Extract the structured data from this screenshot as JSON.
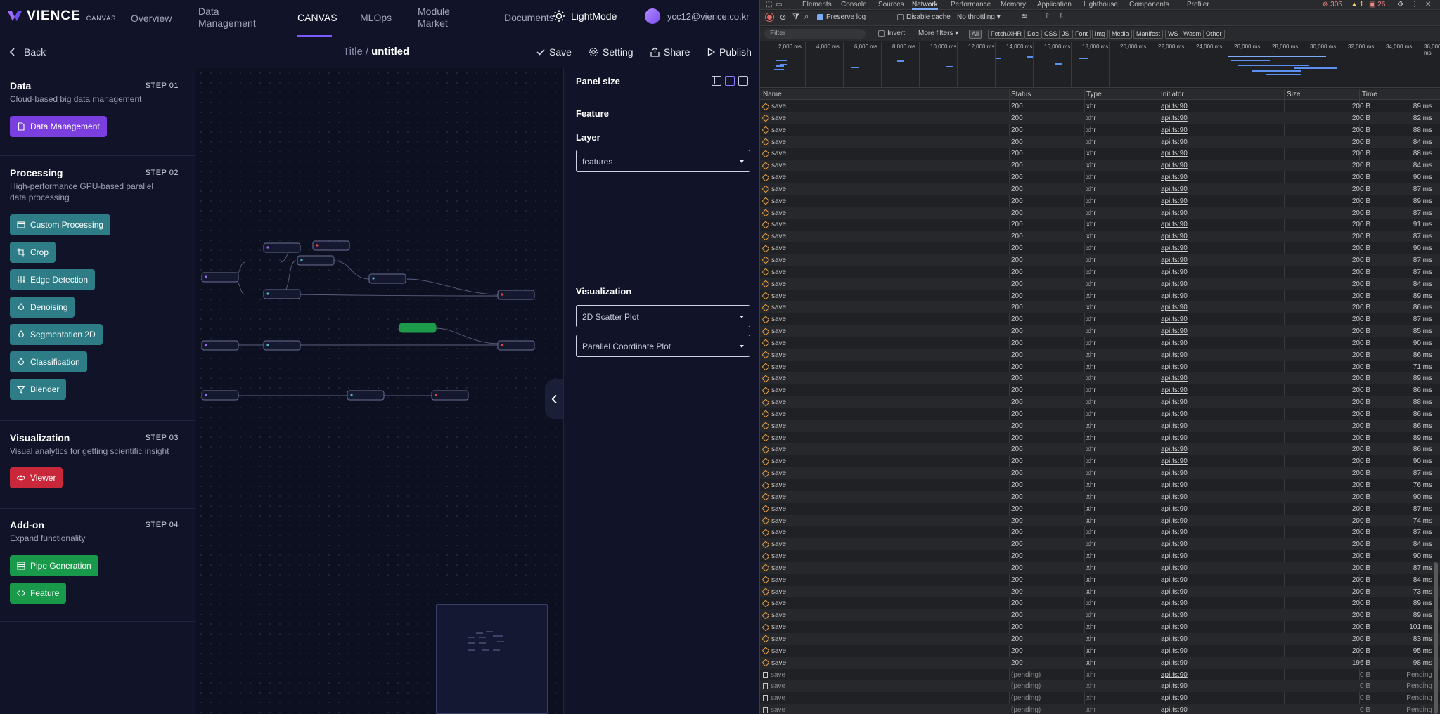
{
  "app": {
    "logo": {
      "brand": "VIENCE",
      "sub": "CANVAS"
    },
    "nav": [
      {
        "label": "Overview"
      },
      {
        "label": "Data Management"
      },
      {
        "label": "CANVAS"
      },
      {
        "label": "MLOps"
      },
      {
        "label": "Module Market"
      },
      {
        "label": "Documents"
      }
    ],
    "theme_label": "LightMode",
    "user_email": "ycc12@vience.co.kr",
    "back_label": "Back",
    "doc": {
      "title_prefix": "Title /",
      "title": "untitled"
    },
    "tools": {
      "save": "Save",
      "setting": "Setting",
      "share": "Share",
      "publish": "Publish"
    },
    "sections": [
      {
        "title": "Data",
        "step": "STEP 01",
        "desc": "Cloud-based big data management",
        "buttons": [
          {
            "label": "Data Management",
            "icon": "file-icon",
            "color": "#7b3fe0"
          }
        ]
      },
      {
        "title": "Processing",
        "step": "STEP 02",
        "desc": "High-performance GPU-based parallel data processing",
        "buttons": [
          {
            "label": "Custom Processing",
            "icon": "window-icon"
          },
          {
            "label": "Crop",
            "icon": "crop-icon"
          },
          {
            "label": "Edge Detection",
            "icon": "sliders-icon"
          },
          {
            "label": "Denoising",
            "icon": "drop-icon"
          },
          {
            "label": "Segmentation 2D",
            "icon": "drop-icon"
          },
          {
            "label": "Classification",
            "icon": "drop-icon"
          },
          {
            "label": "Blender",
            "icon": "filter-icon"
          }
        ]
      },
      {
        "title": "Visualization",
        "step": "STEP 03",
        "desc": "Visual analytics for getting scientific insight",
        "buttons": [
          {
            "label": "Viewer",
            "icon": "eye-icon",
            "color": "#c9283a"
          }
        ]
      },
      {
        "title": "Add-on",
        "step": "STEP 04",
        "desc": "Expand functionality",
        "buttons": [
          {
            "label": "Pipe Generation",
            "icon": "pipe-icon",
            "color": "#199a4b"
          },
          {
            "label": "Feature",
            "icon": "code-icon",
            "color": "#199a4b"
          }
        ]
      }
    ],
    "right_panel": {
      "panel_size": "Panel size",
      "feature": "Feature",
      "layer_label": "Layer",
      "layer_value": "features",
      "visualization": "Visualization",
      "viz_1": "2D Scatter Plot",
      "viz_2": "Parallel Coordinate Plot"
    }
  },
  "devtools": {
    "tabs": [
      "Elements",
      "Console",
      "Sources",
      "Network",
      "Performance",
      "Memory",
      "Application",
      "Lighthouse",
      "Components",
      "Profiler"
    ],
    "active_tab": "Network",
    "counts": {
      "errors": "305",
      "warnings": "1",
      "info": "26"
    },
    "toolbar": {
      "preserve_log": "Preserve log",
      "disable_cache": "Disable cache",
      "throttling": "No throttling"
    },
    "filter": {
      "placeholder": "Filter",
      "invert": "Invert",
      "more_filters": "More filters",
      "chips": [
        "All",
        "Fetch/XHR",
        "Doc",
        "CSS",
        "JS",
        "Font",
        "Img",
        "Media",
        "Manifest",
        "WS",
        "Wasm",
        "Other"
      ]
    },
    "timeline_ticks": [
      "2,000 ms",
      "4,000 ms",
      "6,000 ms",
      "8,000 ms",
      "10,000 ms",
      "12,000 ms",
      "14,000 ms",
      "16,000 ms",
      "18,000 ms",
      "20,000 ms",
      "22,000 ms",
      "24,000 ms",
      "26,000 ms",
      "28,000 ms",
      "30,000 ms",
      "32,000 ms",
      "34,000 ms",
      "36,000 ms"
    ],
    "columns": [
      "Name",
      "Status",
      "Type",
      "Initiator",
      "Size",
      "Time"
    ],
    "rows": [
      {
        "name": "save",
        "status": "200",
        "type": "xhr",
        "initiator": "api.ts:90",
        "size": "200 B",
        "time": "89 ms"
      },
      {
        "name": "save",
        "status": "200",
        "type": "xhr",
        "initiator": "api.ts:90",
        "size": "200 B",
        "time": "82 ms"
      },
      {
        "name": "save",
        "status": "200",
        "type": "xhr",
        "initiator": "api.ts:90",
        "size": "200 B",
        "time": "88 ms"
      },
      {
        "name": "save",
        "status": "200",
        "type": "xhr",
        "initiator": "api.ts:90",
        "size": "200 B",
        "time": "84 ms"
      },
      {
        "name": "save",
        "status": "200",
        "type": "xhr",
        "initiator": "api.ts:90",
        "size": "200 B",
        "time": "88 ms"
      },
      {
        "name": "save",
        "status": "200",
        "type": "xhr",
        "initiator": "api.ts:90",
        "size": "200 B",
        "time": "84 ms"
      },
      {
        "name": "save",
        "status": "200",
        "type": "xhr",
        "initiator": "api.ts:90",
        "size": "200 B",
        "time": "90 ms"
      },
      {
        "name": "save",
        "status": "200",
        "type": "xhr",
        "initiator": "api.ts:90",
        "size": "200 B",
        "time": "87 ms"
      },
      {
        "name": "save",
        "status": "200",
        "type": "xhr",
        "initiator": "api.ts:90",
        "size": "200 B",
        "time": "89 ms"
      },
      {
        "name": "save",
        "status": "200",
        "type": "xhr",
        "initiator": "api.ts:90",
        "size": "200 B",
        "time": "87 ms"
      },
      {
        "name": "save",
        "status": "200",
        "type": "xhr",
        "initiator": "api.ts:90",
        "size": "200 B",
        "time": "91 ms"
      },
      {
        "name": "save",
        "status": "200",
        "type": "xhr",
        "initiator": "api.ts:90",
        "size": "200 B",
        "time": "87 ms"
      },
      {
        "name": "save",
        "status": "200",
        "type": "xhr",
        "initiator": "api.ts:90",
        "size": "200 B",
        "time": "90 ms"
      },
      {
        "name": "save",
        "status": "200",
        "type": "xhr",
        "initiator": "api.ts:90",
        "size": "200 B",
        "time": "87 ms"
      },
      {
        "name": "save",
        "status": "200",
        "type": "xhr",
        "initiator": "api.ts:90",
        "size": "200 B",
        "time": "87 ms"
      },
      {
        "name": "save",
        "status": "200",
        "type": "xhr",
        "initiator": "api.ts:90",
        "size": "200 B",
        "time": "84 ms"
      },
      {
        "name": "save",
        "status": "200",
        "type": "xhr",
        "initiator": "api.ts:90",
        "size": "200 B",
        "time": "89 ms"
      },
      {
        "name": "save",
        "status": "200",
        "type": "xhr",
        "initiator": "api.ts:90",
        "size": "200 B",
        "time": "86 ms"
      },
      {
        "name": "save",
        "status": "200",
        "type": "xhr",
        "initiator": "api.ts:90",
        "size": "200 B",
        "time": "87 ms"
      },
      {
        "name": "save",
        "status": "200",
        "type": "xhr",
        "initiator": "api.ts:90",
        "size": "200 B",
        "time": "85 ms"
      },
      {
        "name": "save",
        "status": "200",
        "type": "xhr",
        "initiator": "api.ts:90",
        "size": "200 B",
        "time": "90 ms"
      },
      {
        "name": "save",
        "status": "200",
        "type": "xhr",
        "initiator": "api.ts:90",
        "size": "200 B",
        "time": "86 ms"
      },
      {
        "name": "save",
        "status": "200",
        "type": "xhr",
        "initiator": "api.ts:90",
        "size": "200 B",
        "time": "71 ms"
      },
      {
        "name": "save",
        "status": "200",
        "type": "xhr",
        "initiator": "api.ts:90",
        "size": "200 B",
        "time": "89 ms"
      },
      {
        "name": "save",
        "status": "200",
        "type": "xhr",
        "initiator": "api.ts:90",
        "size": "200 B",
        "time": "86 ms"
      },
      {
        "name": "save",
        "status": "200",
        "type": "xhr",
        "initiator": "api.ts:90",
        "size": "200 B",
        "time": "88 ms"
      },
      {
        "name": "save",
        "status": "200",
        "type": "xhr",
        "initiator": "api.ts:90",
        "size": "200 B",
        "time": "86 ms"
      },
      {
        "name": "save",
        "status": "200",
        "type": "xhr",
        "initiator": "api.ts:90",
        "size": "200 B",
        "time": "86 ms"
      },
      {
        "name": "save",
        "status": "200",
        "type": "xhr",
        "initiator": "api.ts:90",
        "size": "200 B",
        "time": "89 ms"
      },
      {
        "name": "save",
        "status": "200",
        "type": "xhr",
        "initiator": "api.ts:90",
        "size": "200 B",
        "time": "86 ms"
      },
      {
        "name": "save",
        "status": "200",
        "type": "xhr",
        "initiator": "api.ts:90",
        "size": "200 B",
        "time": "90 ms"
      },
      {
        "name": "save",
        "status": "200",
        "type": "xhr",
        "initiator": "api.ts:90",
        "size": "200 B",
        "time": "87 ms"
      },
      {
        "name": "save",
        "status": "200",
        "type": "xhr",
        "initiator": "api.ts:90",
        "size": "200 B",
        "time": "76 ms"
      },
      {
        "name": "save",
        "status": "200",
        "type": "xhr",
        "initiator": "api.ts:90",
        "size": "200 B",
        "time": "90 ms"
      },
      {
        "name": "save",
        "status": "200",
        "type": "xhr",
        "initiator": "api.ts:90",
        "size": "200 B",
        "time": "87 ms"
      },
      {
        "name": "save",
        "status": "200",
        "type": "xhr",
        "initiator": "api.ts:90",
        "size": "200 B",
        "time": "74 ms"
      },
      {
        "name": "save",
        "status": "200",
        "type": "xhr",
        "initiator": "api.ts:90",
        "size": "200 B",
        "time": "87 ms"
      },
      {
        "name": "save",
        "status": "200",
        "type": "xhr",
        "initiator": "api.ts:90",
        "size": "200 B",
        "time": "84 ms"
      },
      {
        "name": "save",
        "status": "200",
        "type": "xhr",
        "initiator": "api.ts:90",
        "size": "200 B",
        "time": "90 ms"
      },
      {
        "name": "save",
        "status": "200",
        "type": "xhr",
        "initiator": "api.ts:90",
        "size": "200 B",
        "time": "87 ms"
      },
      {
        "name": "save",
        "status": "200",
        "type": "xhr",
        "initiator": "api.ts:90",
        "size": "200 B",
        "time": "84 ms"
      },
      {
        "name": "save",
        "status": "200",
        "type": "xhr",
        "initiator": "api.ts:90",
        "size": "200 B",
        "time": "73 ms"
      },
      {
        "name": "save",
        "status": "200",
        "type": "xhr",
        "initiator": "api.ts:90",
        "size": "200 B",
        "time": "89 ms"
      },
      {
        "name": "save",
        "status": "200",
        "type": "xhr",
        "initiator": "api.ts:90",
        "size": "200 B",
        "time": "89 ms"
      },
      {
        "name": "save",
        "status": "200",
        "type": "xhr",
        "initiator": "api.ts:90",
        "size": "200 B",
        "time": "101 ms"
      },
      {
        "name": "save",
        "status": "200",
        "type": "xhr",
        "initiator": "api.ts:90",
        "size": "200 B",
        "time": "83 ms"
      },
      {
        "name": "save",
        "status": "200",
        "type": "xhr",
        "initiator": "api.ts:90",
        "size": "200 B",
        "time": "95 ms"
      },
      {
        "name": "save",
        "status": "200",
        "type": "xhr",
        "initiator": "api.ts:90",
        "size": "196 B",
        "time": "98 ms"
      },
      {
        "name": "save",
        "status": "(pending)",
        "type": "xhr",
        "initiator": "api.ts:90",
        "size": "0 B",
        "time": "Pending"
      },
      {
        "name": "save",
        "status": "(pending)",
        "type": "xhr",
        "initiator": "api.ts:90",
        "size": "0 B",
        "time": "Pending"
      },
      {
        "name": "save",
        "status": "(pending)",
        "type": "xhr",
        "initiator": "api.ts:90",
        "size": "0 B",
        "time": "Pending"
      },
      {
        "name": "save",
        "status": "(pending)",
        "type": "xhr",
        "initiator": "api.ts:90",
        "size": "0 B",
        "time": "Pending"
      }
    ]
  }
}
